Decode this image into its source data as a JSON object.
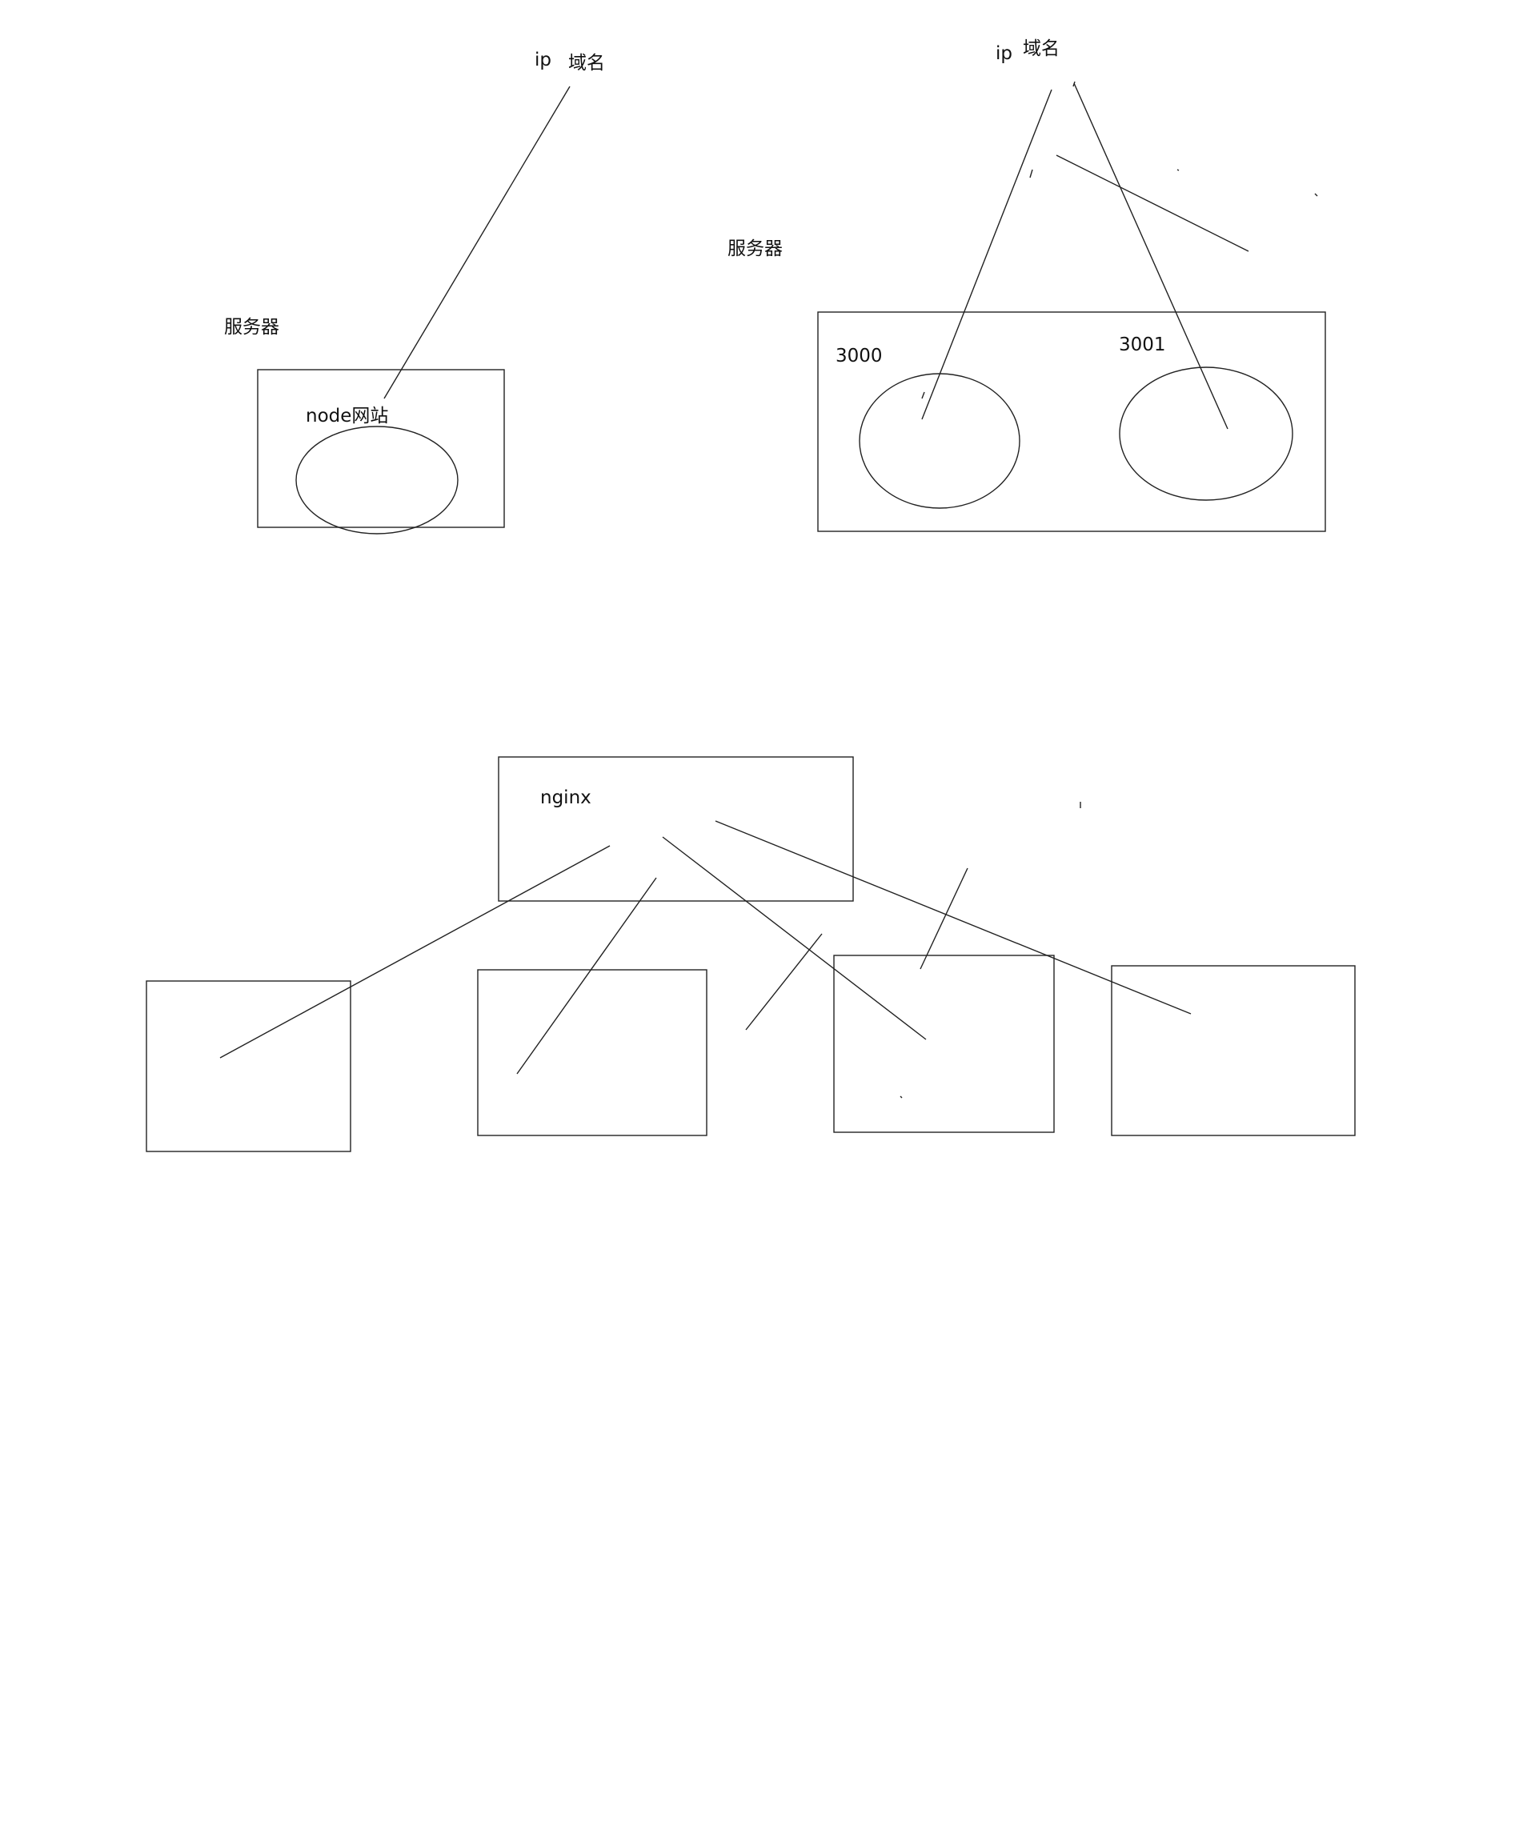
{
  "diagram1": {
    "top_labels": {
      "ip": "ip",
      "domain": "域名"
    },
    "server_label": "服务器",
    "site_label": "node网站"
  },
  "diagram2": {
    "top_labels": {
      "ip": "ip",
      "domain": "域名"
    },
    "server_label": "服务器",
    "port_a": "3000",
    "port_b": "3001"
  },
  "diagram3": {
    "proxy_label": "nginx"
  }
}
